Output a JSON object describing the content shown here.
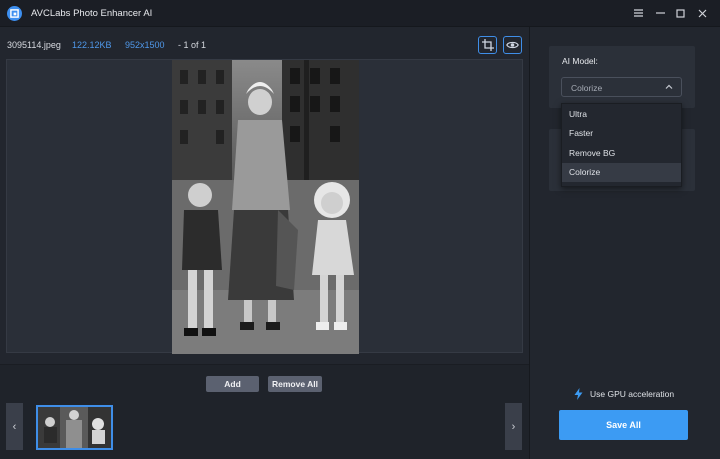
{
  "app": {
    "title": "AVCLabs Photo Enhancer AI"
  },
  "file": {
    "name": "3095114.jpeg",
    "size": "122.12KB",
    "dimensions": "952x1500",
    "count": "- 1 of 1"
  },
  "actions": {
    "add": "Add",
    "remove_all": "Remove All"
  },
  "model": {
    "label": "AI Model:",
    "selected": "Colorize",
    "options": [
      "Ultra",
      "Faster",
      "Remove BG",
      "Colorize"
    ]
  },
  "gpu": {
    "label": "Use GPU acceleration"
  },
  "save": {
    "label": "Save All"
  },
  "colors": {
    "accent": "#3c9bf3",
    "panel": "#2b3039",
    "bg": "#22262e"
  }
}
